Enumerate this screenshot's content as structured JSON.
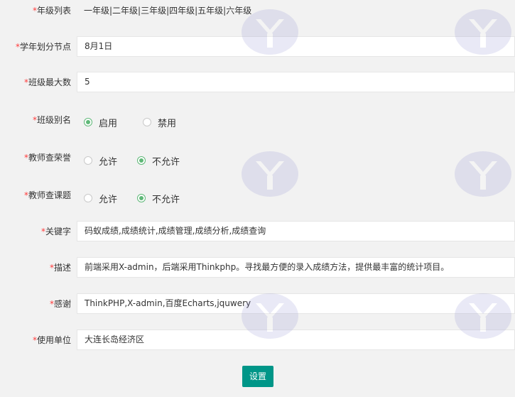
{
  "form": {
    "required_mark": "*",
    "fields": [
      {
        "label": "年级列表",
        "value": "一年级|二年级|三年级|四年级|五年级|六年级"
      },
      {
        "label": "学年划分节点",
        "value": "8月1日"
      },
      {
        "label": "班级最大数",
        "value": "5"
      },
      {
        "label": "班级别名",
        "options": [
          "启用",
          "禁用"
        ],
        "selected": "启用"
      },
      {
        "label": "教师查荣誉",
        "options": [
          "允许",
          "不允许"
        ],
        "selected": "不允许"
      },
      {
        "label": "教师查课题",
        "options": [
          "允许",
          "不允许"
        ],
        "selected": "不允许"
      },
      {
        "label": "关键字",
        "value": "码蚁成绩,成绩统计,成绩管理,成绩分析,成绩查询"
      },
      {
        "label": "描述",
        "value": "前端采用X-admin，后端采用Thinkphp。寻找最方便的录入成绩方法，提供最丰富的统计项目。"
      },
      {
        "label": "感谢",
        "value": "ThinkPHP,X-admin,百度Echarts,jquwery"
      },
      {
        "label": "使用单位",
        "value": "大连长岛经济区"
      }
    ],
    "submit_label": "设置"
  },
  "colors": {
    "accent": "#009688",
    "radio_checked": "#5fb878",
    "required": "#ff3b3b",
    "background": "#f2f2f2"
  },
  "watermark_icon": "logo-watermark-icon"
}
